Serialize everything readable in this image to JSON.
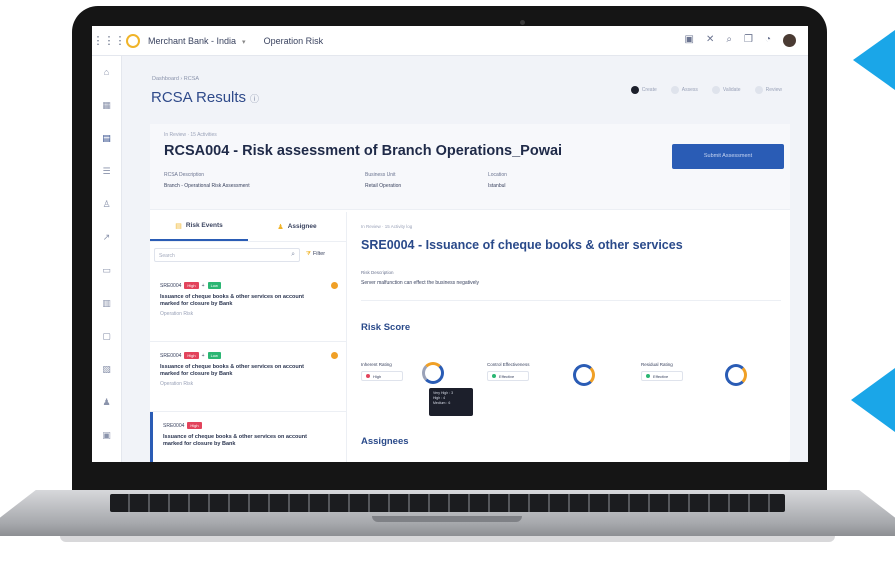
{
  "topbar": {
    "app": "Merchant Bank - India",
    "module": "Operation Risk"
  },
  "header": {
    "breadcrumb": "Dashboard › RCSA",
    "title": "RCSA Results",
    "steps": [
      "Create",
      "Assess",
      "Validate",
      "Review"
    ]
  },
  "rcsa": {
    "meta": "In Review · 15 Activities",
    "title": "RCSA004 - Risk assessment of  Branch Operations_Powai",
    "fields": [
      {
        "key": "RCSA Description",
        "value": "Branch - Operational Risk Assessment"
      },
      {
        "key": "Business Unit",
        "value": "Retail Operation"
      },
      {
        "key": "Location",
        "value": "Istanbul"
      }
    ],
    "submit_label": "Submit Assessment"
  },
  "list": {
    "tabs": [
      "Risk Events",
      "Assignee"
    ],
    "search_placeholder": "Search",
    "filter_label": "Filter",
    "items": [
      {
        "code": "SRE0004",
        "tag1": "High",
        "tag2": "Low",
        "text": "Issuance of cheque books  & other services on account marked for closure by Bank",
        "sub": "Operation Risk"
      },
      {
        "code": "SRE0004",
        "tag1": "High",
        "tag2": "Low",
        "text": "Issuance of cheque books  & other services on account marked for closure by Bank",
        "sub": "Operation Risk"
      },
      {
        "code": "SRE0004",
        "tag1": "High",
        "text": "Issuance of cheque books  & other services on account marked for closure by Bank",
        "sub": ""
      }
    ]
  },
  "detail": {
    "meta": "In Review · 15 Activity log",
    "title": "SRE0004 - Issuance of cheque books  & other services",
    "desc_label": "Risk Description",
    "desc": "Server malfunction can effect the business negatively",
    "risk_score": "Risk Score",
    "ratings": [
      {
        "label": "Inherent Rating",
        "chip": "High",
        "color": "#e2445c"
      },
      {
        "label": "Control Effectiveness",
        "chip": "Effective",
        "color": "#2bb673"
      },
      {
        "label": "Residual Rating",
        "chip": "Effective",
        "color": "#2bb673"
      }
    ],
    "tooltip": [
      "Very High : 3",
      "High : 4",
      "Medium : 6"
    ],
    "assignees": "Assignees"
  }
}
